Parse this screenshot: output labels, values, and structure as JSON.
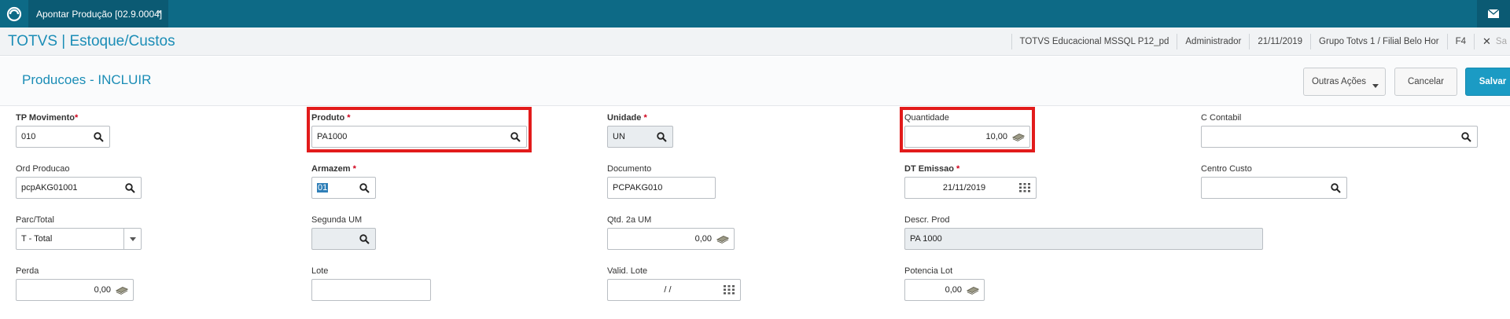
{
  "tab": {
    "title": "Apontar Produção [02.9.0004]",
    "close": "×"
  },
  "header": {
    "app_title": "TOTVS | Estoque/Custos",
    "environment": "TOTVS Educacional MSSQL P12_pd",
    "user": "Administrador",
    "date": "21/11/2019",
    "branch": "Grupo Totvs 1 / Filial Belo Hor",
    "shortcut": "F4",
    "exit_label": "Sa"
  },
  "page": {
    "title": "Producoes - INCLUIR"
  },
  "actions": {
    "more_label": "Outras Ações",
    "cancel_label": "Cancelar",
    "save_label": "Salvar"
  },
  "required_mark": "*",
  "fields": {
    "tp_movimento": {
      "label": "TP Movimento",
      "value": "010"
    },
    "ord_producao": {
      "label": "Ord Producao",
      "value": "pcpAKG01001"
    },
    "parc_total": {
      "label": "Parc/Total",
      "value": "T - Total"
    },
    "perda": {
      "label": "Perda",
      "value": "0,00"
    },
    "produto": {
      "label": "Produto",
      "value": "PA1000"
    },
    "armazem": {
      "label": "Armazem",
      "value": "01"
    },
    "segunda_um": {
      "label": "Segunda UM",
      "value": ""
    },
    "lote": {
      "label": "Lote",
      "value": ""
    },
    "unidade": {
      "label": "Unidade",
      "value": "UN"
    },
    "documento": {
      "label": "Documento",
      "value": "PCPAKG010"
    },
    "qtd_2a_um": {
      "label": "Qtd. 2a UM",
      "value": "0,00"
    },
    "valid_lote": {
      "label": "Valid. Lote",
      "value": "/ /"
    },
    "quantidade": {
      "label": "Quantidade",
      "value": "10,00"
    },
    "dt_emissao": {
      "label": "DT Emissao",
      "value": "21/11/2019"
    },
    "descr_prod": {
      "label": "Descr. Prod",
      "value": "PA 1000"
    },
    "potencia_lot": {
      "label": "Potencia Lot",
      "value": "0,00"
    },
    "c_contabil": {
      "label": "C Contabil",
      "value": ""
    },
    "centro_custo": {
      "label": "Centro Custo",
      "value": ""
    }
  },
  "colors": {
    "topbar": "#0d6a86",
    "accent": "#1b8db6",
    "highlight": "#e21b1b",
    "save": "#1b9bc4"
  },
  "icons": [
    "totvs-logo-icon",
    "mail-icon",
    "search-icon",
    "calendar-icon",
    "money-icon",
    "chevron-down-icon",
    "close-icon"
  ]
}
